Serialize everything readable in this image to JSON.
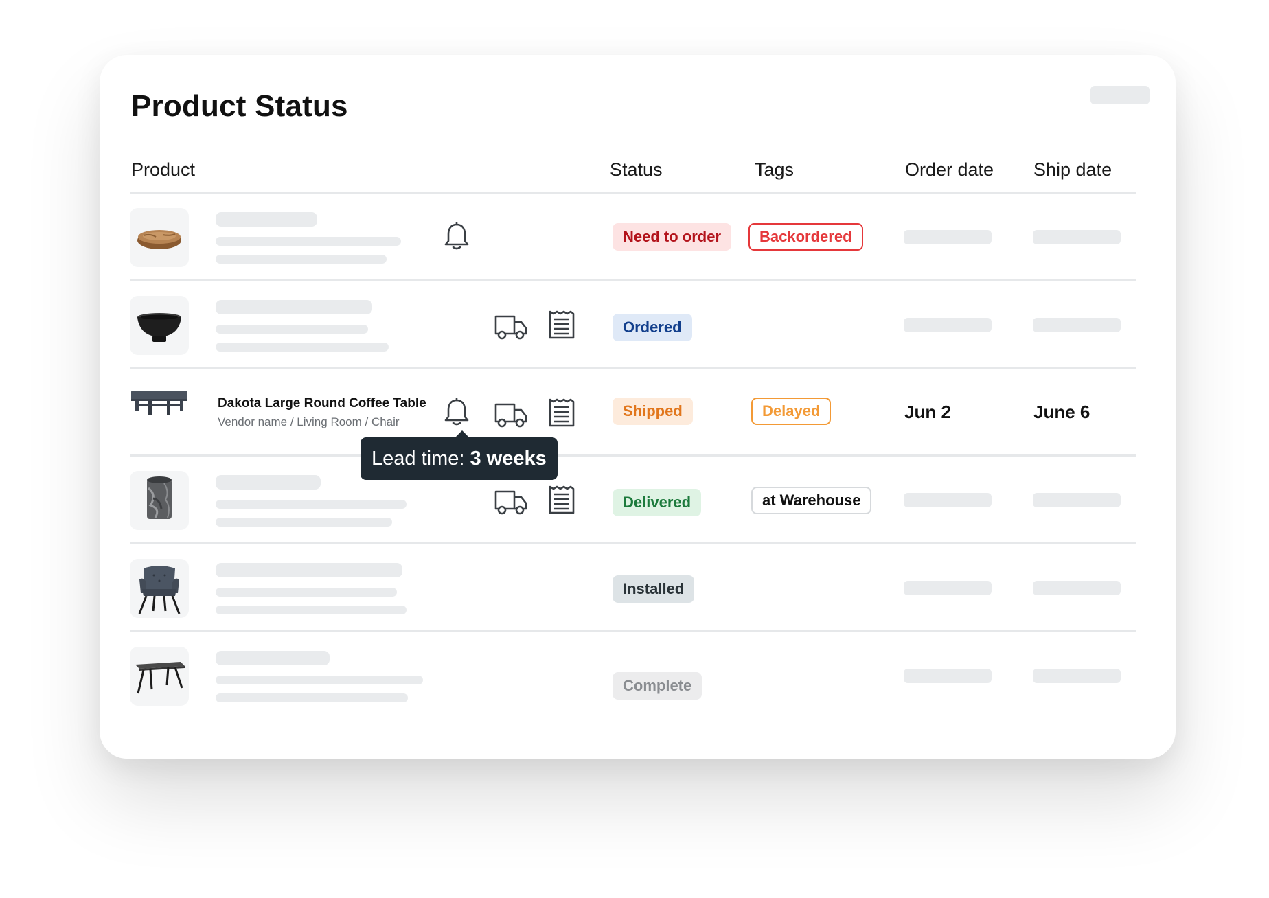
{
  "page": {
    "title": "Product Status"
  },
  "columns": {
    "product": "Product",
    "status": "Status",
    "tags": "Tags",
    "order_date": "Order date",
    "ship_date": "Ship date"
  },
  "rows": [
    {
      "image": "wooden-bowl",
      "status": "Need to order",
      "status_style": "need-to-order",
      "tag": "Backordered",
      "tag_style": "backordered",
      "icons": [
        "bell-icon"
      ]
    },
    {
      "image": "black-pedestal-bowl",
      "status": "Ordered",
      "status_style": "ordered",
      "icons": [
        "truck-icon",
        "receipt-icon"
      ]
    },
    {
      "image": "round-coffee-table",
      "name": "Dakota Large Round Coffee Table",
      "meta": "Vendor name / Living Room / Chair",
      "status": "Shipped",
      "status_style": "shipped",
      "tag": "Delayed",
      "tag_style": "delayed",
      "order_date": "Jun 2",
      "ship_date": "June 6",
      "icons": [
        "bell-icon",
        "truck-icon",
        "receipt-icon"
      ]
    },
    {
      "image": "marble-vase",
      "status": "Delivered",
      "status_style": "delivered",
      "tag": "at Warehouse",
      "tag_style": "warehouse",
      "icons": [
        "truck-icon",
        "receipt-icon"
      ]
    },
    {
      "image": "velvet-armchair",
      "status": "Installed",
      "status_style": "installed",
      "icons": []
    },
    {
      "image": "dining-table",
      "status": "Complete",
      "status_style": "complete",
      "icons": []
    }
  ],
  "tooltip": {
    "label": "Lead time:",
    "value": "3 weeks"
  },
  "colors": {
    "need_to_order": {
      "bg": "#fde3e3",
      "fg": "#b3131b"
    },
    "ordered": {
      "bg": "#dfe9f7",
      "fg": "#123f8c"
    },
    "shipped": {
      "bg": "#fdebdc",
      "fg": "#e1761c"
    },
    "delivered": {
      "bg": "#dff3e4",
      "fg": "#1c7a3c"
    },
    "installed": {
      "bg": "#dde3e6",
      "fg": "#2a3338"
    },
    "complete": {
      "bg": "#ececed",
      "fg": "#8a8d91"
    },
    "backordered_tag": "#e5383b",
    "delayed_tag": "#f39a36",
    "warehouse_tag_border": "#d6d9dc",
    "tooltip_bg": "#1f2a33",
    "skeleton": "#e9ebed"
  }
}
